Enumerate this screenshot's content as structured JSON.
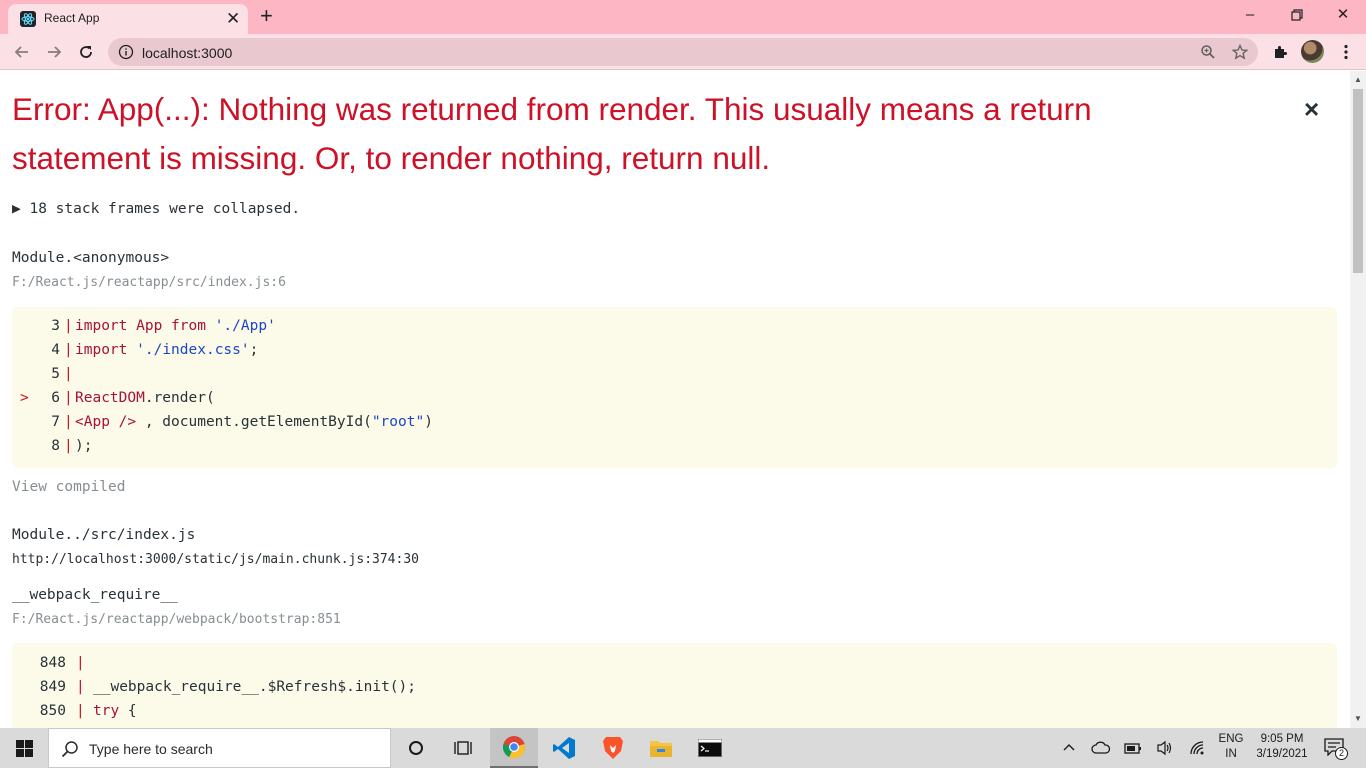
{
  "browser": {
    "tab_title": "React App",
    "url": "localhost:3000"
  },
  "error": {
    "title": "Error: App(...): Nothing was returned from render. This usually means a return statement is missing. Or, to render nothing, return null.",
    "close_symbol": "×",
    "collapsed_toggle": "▶ 18 stack frames were collapsed.",
    "frames": [
      {
        "name": "Module.<anonymous>",
        "location": "F:/React.js/reactapp/src/index.js:6",
        "code": [
          {
            "num": "3",
            "marker": "",
            "parts": [
              {
                "t": "import",
                "c": "kw"
              },
              {
                "t": " App ",
                "c": "kw"
              },
              {
                "t": "from",
                "c": "kw"
              },
              {
                "t": " ",
                "c": ""
              },
              {
                "t": "'./App'",
                "c": "str"
              }
            ]
          },
          {
            "num": "4",
            "marker": "",
            "parts": [
              {
                "t": "import",
                "c": "kw"
              },
              {
                "t": " ",
                "c": ""
              },
              {
                "t": "'./index.css'",
                "c": "str"
              },
              {
                "t": ";",
                "c": ""
              }
            ]
          },
          {
            "num": "5",
            "marker": "",
            "parts": []
          },
          {
            "num": "6",
            "marker": ">",
            "parts": [
              {
                "t": "ReactDOM",
                "c": "kw"
              },
              {
                "t": ".render(",
                "c": ""
              }
            ]
          },
          {
            "num": "7",
            "marker": "",
            "parts": [
              {
                "t": "<App />",
                "c": "kw"
              },
              {
                "t": " , document.getElementById(",
                "c": ""
              },
              {
                "t": "\"root\"",
                "c": "str"
              },
              {
                "t": ")",
                "c": ""
              }
            ]
          },
          {
            "num": "8",
            "marker": "",
            "parts": [
              {
                "t": ");",
                "c": ""
              }
            ]
          }
        ],
        "view_compiled": "View compiled"
      },
      {
        "name": "Module../src/index.js",
        "location": "http://localhost:3000/static/js/main.chunk.js:374:30"
      },
      {
        "name": "__webpack_require__",
        "location": "F:/React.js/reactapp/webpack/bootstrap:851",
        "code": [
          {
            "num": "848",
            "marker": "",
            "parts": []
          },
          {
            "num": "849",
            "marker": "",
            "parts": [
              {
                "t": "__webpack_require__.$Refresh$.init();",
                "c": ""
              }
            ]
          },
          {
            "num": "850",
            "marker": "",
            "parts": [
              {
                "t": "try",
                "c": "kw"
              },
              {
                "t": " {",
                "c": ""
              }
            ]
          }
        ]
      }
    ]
  },
  "taskbar": {
    "search_placeholder": "Type here to search",
    "language": "ENG",
    "region": "IN",
    "time": "9:05 PM",
    "date": "3/19/2021",
    "notification_count": "2"
  }
}
